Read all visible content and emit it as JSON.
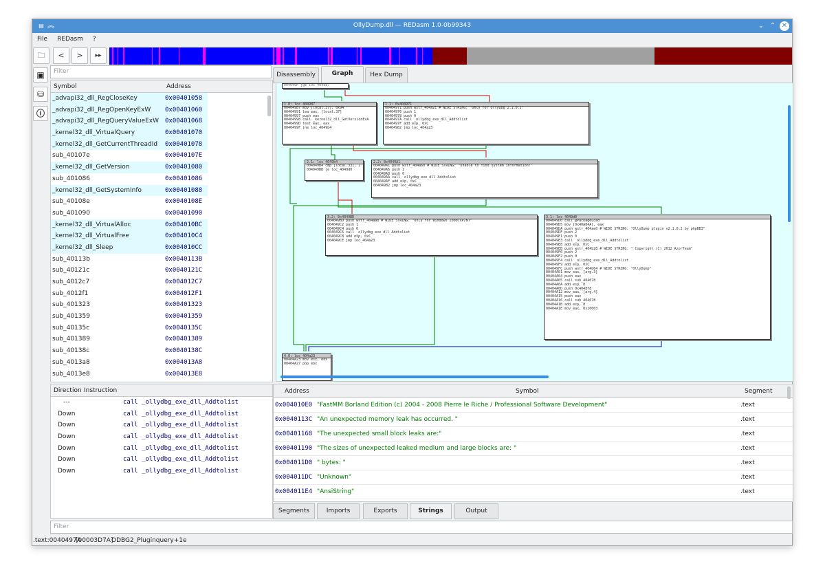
{
  "window": {
    "title": "OllyDump.dll — REDasm 1.0-0b99343"
  },
  "menu": [
    "File",
    "REDasm",
    "?"
  ],
  "left": {
    "filter_placeholder": "Filter",
    "headers": {
      "symbol": "Symbol",
      "address": "Address"
    },
    "rows": [
      {
        "s": "_advapi32_dll_RegCloseKey",
        "a": "0x00401058",
        "imp": true
      },
      {
        "s": "_advapi32_dll_RegOpenKeyExW",
        "a": "0x00401060",
        "imp": true
      },
      {
        "s": "_advapi32_dll_RegQueryValueExW",
        "a": "0x00401068",
        "imp": true
      },
      {
        "s": "_kernel32_dll_VirtualQuery",
        "a": "0x00401070",
        "imp": true
      },
      {
        "s": "_kernel32_dll_GetCurrentThreadId",
        "a": "0x00401078",
        "imp": true
      },
      {
        "s": "sub_40107e",
        "a": "0x0040107E",
        "imp": false
      },
      {
        "s": "_kernel32_dll_GetVersion",
        "a": "0x00401080",
        "imp": true
      },
      {
        "s": "sub_401086",
        "a": "0x00401086",
        "imp": false
      },
      {
        "s": "_kernel32_dll_GetSystemInfo",
        "a": "0x00401088",
        "imp": true
      },
      {
        "s": "sub_40108e",
        "a": "0x0040108E",
        "imp": false
      },
      {
        "s": "sub_401090",
        "a": "0x00401090",
        "imp": false
      },
      {
        "s": "_kernel32_dll_VirtualAlloc",
        "a": "0x004010BC",
        "imp": true
      },
      {
        "s": "_kernel32_dll_VirtualFree",
        "a": "0x004010C4",
        "imp": true
      },
      {
        "s": "_kernel32_dll_Sleep",
        "a": "0x004010CC",
        "imp": true
      },
      {
        "s": "sub_40113b",
        "a": "0x0040113B",
        "imp": false
      },
      {
        "s": "sub_40121c",
        "a": "0x0040121C",
        "imp": false
      },
      {
        "s": "sub_4012c7",
        "a": "0x004012C7",
        "imp": false
      },
      {
        "s": "sub_4012f1",
        "a": "0x004012F1",
        "imp": false
      },
      {
        "s": "sub_401323",
        "a": "0x00401323",
        "imp": false
      },
      {
        "s": "sub_401359",
        "a": "0x00401359",
        "imp": false
      },
      {
        "s": "sub_40135c",
        "a": "0x0040135C",
        "imp": false
      },
      {
        "s": "sub_401389",
        "a": "0x00401389",
        "imp": false
      },
      {
        "s": "sub_40138c",
        "a": "0x0040138C",
        "imp": false
      },
      {
        "s": "sub_4013a8",
        "a": "0x004013A8",
        "imp": false
      },
      {
        "s": "sub_4013e8",
        "a": "0x004013E8",
        "imp": false
      }
    ]
  },
  "tabs": [
    "Disassembly",
    "Graph",
    "Hex Dump"
  ],
  "graph": {
    "blocks": [
      {
        "title": "",
        "lines": [
          "004049F jge loc_404987"
        ]
      },
      {
        "title": "1.0: loc_404987",
        "lines": [
          "00404987 mov [local.37], 0x94",
          "00404991 lea eax, [local.37]",
          "00404997 push eax",
          "00404998 call _kernel32_dll_GetVersionExA",
          "0040499D test eax, eax",
          "0040499F jne loc_4049b4"
        ]
      },
      {
        "title": "1.1: 0x404971",
        "lines": [
          "00404971 push wstr_404a2c        # WIDE STRING: \"Only for OllyDbg 2.1.0.2\"",
          "00404976 push 1",
          "00404978 push 0",
          "0040497A call _ollydbg_exe_dll_Addtolist",
          "0040497F add esp, 0xC",
          "00404982 jmp loc_404a23"
        ]
      },
      {
        "title": "2.1: loc_4049b4",
        "lines": [
          "004049B4 cmp [local.33], 2",
          "004049BB je loc_4049d0"
        ]
      },
      {
        "title": "2.2: 0x4049A1",
        "lines": [
          "004049A1 push wstr_404a60        # WIDE STRING: \"Unable to find system information!\"",
          "004049A6 push 1",
          "004049A8 push 0",
          "004049AA call _ollydbg_exe_dll_Addtolist",
          "004049AF add esp, 0xC",
          "004049B2 jmp loc_404a23"
        ]
      },
      {
        "title": "3.2: 0x4049BD",
        "lines": [
          "004049BD push wstr_404aa8        # WIDE STRING: \"Only for Windows 2000/XP/NT\"",
          "004049C2 push 1",
          "004049C4 push 0",
          "004049C6 call _ollydbg_exe_dll_Addtolist",
          "004049CB add esp, 0xC",
          "004049CE jmp loc_404a23"
        ]
      },
      {
        "title": "3.1: loc_4049d0",
        "lines": [
          "004049D0 call @PackageLoad",
          "004049D5 mov [0x40A84A], eax",
          "004049DA push wstr_404ae0        # WIDE STRING: \"OllyDump plugin v2.1.0.2 by phpBB3\"",
          "004049DF push 2",
          "004049E1 push 0",
          "004049E3 call _ollydbg_exe_dll_Addtolist",
          "004049E8 add esp, 0xC",
          "004049EB push wstr_404b28        # WIDE STRING: \"  Copyright (C) 2012 AzorTeam\"",
          "004049F0 push 2",
          "004049F2 push 0",
          "004049F4 call _ollydbg_exe_dll_Addtolist",
          "004049F9 add esp, 0xC",
          "004049FC push wstr_404b64        # WIDE STRING: \"OllyDump\"",
          "00404A01 mov eax, [arg.3]",
          "00404A04 push eax",
          "00404A05 call sub_404078",
          "00404A0A add esp, 8",
          "00404A0D push 0x404878",
          "00404A12 mov eax, [arg.4]",
          "00404A15 push eax",
          "00404A16 call sub_404078",
          "00404A1B add esp, 8",
          "00404A1E mov eax, 0x20003"
        ]
      },
      {
        "title": "4.0: loc_404a23",
        "lines": [
          "00404A23 mov esx, ebx",
          "00404A27 pop ebx"
        ]
      }
    ]
  },
  "xref": {
    "headers": {
      "direction": "Direction",
      "instruction": "Instruction"
    },
    "rows": [
      {
        "d": "---",
        "i": "call _ollydbg_exe_dll_Addtolist"
      },
      {
        "d": "Down",
        "i": "call _ollydbg_exe_dll_Addtolist"
      },
      {
        "d": "Down",
        "i": "call _ollydbg_exe_dll_Addtolist"
      },
      {
        "d": "Down",
        "i": "call _ollydbg_exe_dll_Addtolist"
      },
      {
        "d": "Down",
        "i": "call _ollydbg_exe_dll_Addtolist"
      },
      {
        "d": "Down",
        "i": "call _ollydbg_exe_dll_Addtolist"
      },
      {
        "d": "Down",
        "i": "call _ollydbg_exe_dll_Addtolist"
      }
    ],
    "filter_placeholder": "Filter"
  },
  "strings": {
    "headers": {
      "address": "Address",
      "symbol": "Symbol",
      "segment": "Segment"
    },
    "rows": [
      {
        "a": "0x004010E0",
        "s": "\"FastMM Borland Edition (c) 2004 - 2008 Pierre le Riche / Professional Software Development\"",
        "g": ".text"
      },
      {
        "a": "0x0040113C",
        "s": "\"An unexpected memory leak has occurred. \"",
        "g": ".text"
      },
      {
        "a": "0x00401168",
        "s": "\"The unexpected small block leaks are:\"",
        "g": ".text"
      },
      {
        "a": "0x00401190",
        "s": "\"The sizes of unexpected leaked medium and large blocks are: \"",
        "g": ".text"
      },
      {
        "a": "0x004011D0",
        "s": "\" bytes: \"",
        "g": ".text"
      },
      {
        "a": "0x004011DC",
        "s": "\"Unknown\"",
        "g": ".text"
      },
      {
        "a": "0x004011E4",
        "s": "\"AnsiString\"",
        "g": ".text"
      }
    ]
  },
  "bottom_tabs": [
    "Segments",
    "Imports",
    "Exports",
    "Strings",
    "Output"
  ],
  "status": {
    "addr": ".text:0040497A",
    "offset": "[00003D7A]",
    "symbol": "ODBG2_Pluginquery+1e"
  },
  "colors": {
    "titlebar": "#4b91d3",
    "graph_bg": "#e1ffff",
    "import_row": "#e0fbff",
    "nav_blue": "#0000ff",
    "nav_magenta": "#ff00ff",
    "nav_red": "#800000",
    "nav_gray": "#a0a0a0"
  }
}
